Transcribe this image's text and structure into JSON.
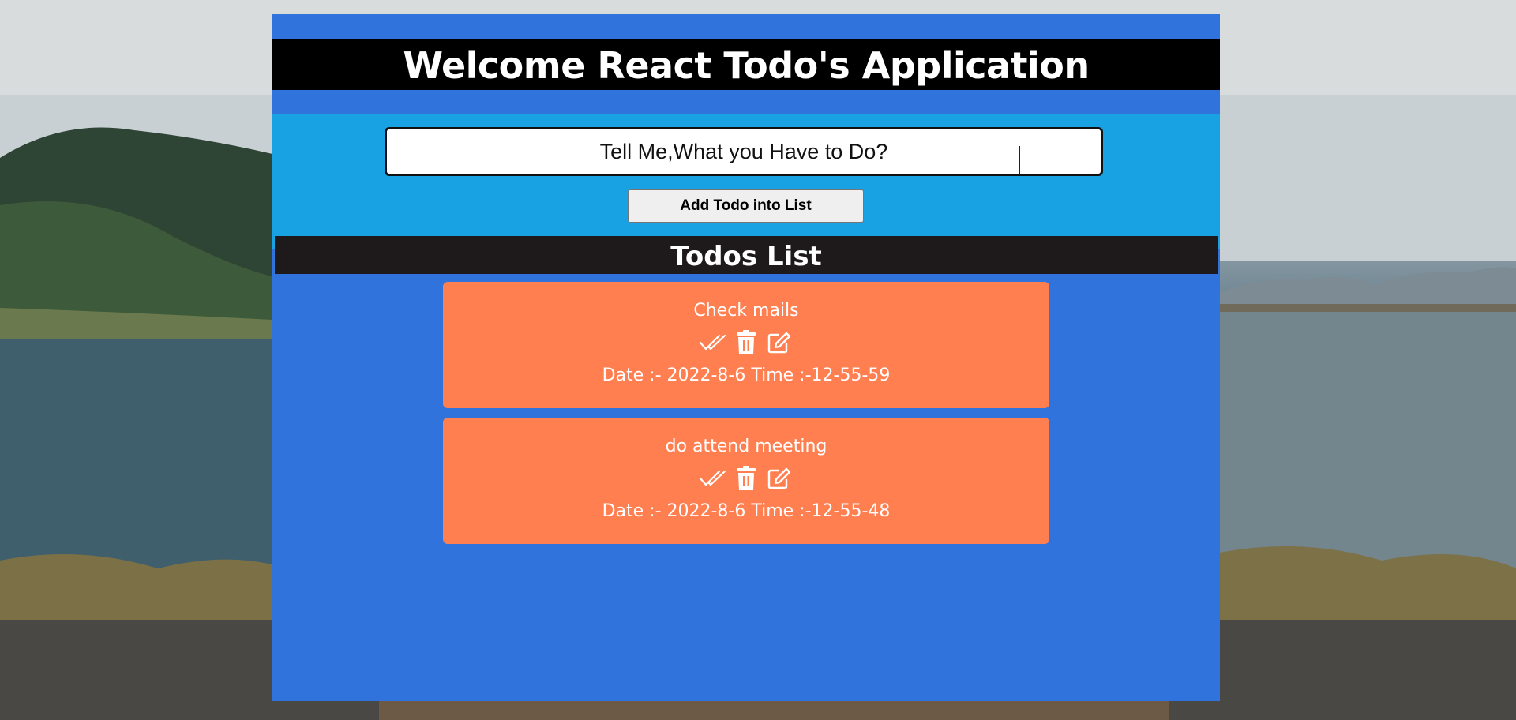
{
  "header": {
    "title": "Welcome React Todo's Application"
  },
  "input": {
    "placeholder": "Tell Me,What you Have to Do?",
    "value": ""
  },
  "add_button": {
    "label": "Add Todo into List"
  },
  "list": {
    "title": "Todos List",
    "items": [
      {
        "text": "Check mails",
        "date_line": "Date :- 2022-8-6 Time :-12-55-59",
        "icons": [
          "double-check-icon",
          "trash-icon",
          "edit-icon"
        ]
      },
      {
        "text": "do attend meeting",
        "date_line": "Date :- 2022-8-6 Time :-12-55-48",
        "icons": [
          "double-check-icon",
          "trash-icon",
          "edit-icon"
        ]
      }
    ]
  },
  "colors": {
    "app_background": "#3073dd",
    "input_section": "#18a2e4",
    "title_bar": "#000000",
    "list_header": "#1e1a1b",
    "todo_card": "#ff7f50",
    "text_light": "#ffffff"
  }
}
